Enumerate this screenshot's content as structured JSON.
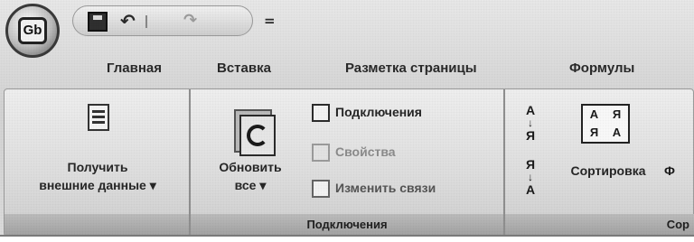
{
  "office_button": {
    "logo": "Gb"
  },
  "quick_access": {
    "more": "="
  },
  "tabs": [
    "Главная",
    "Вставка",
    "Разметка страницы",
    "Формулы"
  ],
  "groups": {
    "external": {
      "get_data_line1": "Получить",
      "get_data_line2": "внешние данные",
      "dropdown": "▾"
    },
    "connections": {
      "refresh_line1": "Обновить",
      "refresh_line2": "все",
      "dropdown": "▾",
      "items": [
        "Подключения",
        "Свойства",
        "Изменить связи"
      ],
      "label": "Подключения"
    },
    "sort": {
      "sort_label": "Сортировка",
      "sort_grid": [
        "А",
        "Я",
        "Я",
        "А"
      ],
      "az_top": "А",
      "az_bottom": "Я",
      "za_top": "Я",
      "za_bottom": "А",
      "partial_label": "Сор",
      "partial_next": "Ф"
    }
  }
}
